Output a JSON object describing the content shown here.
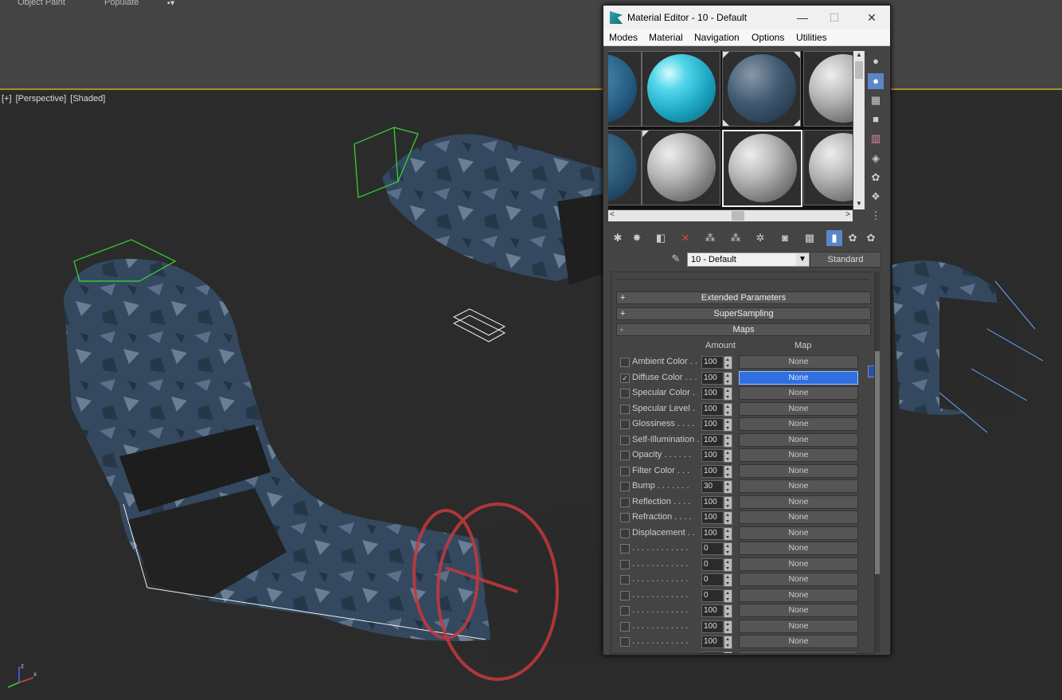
{
  "app": {
    "top_tabs": [
      "Object Paint",
      "Populate"
    ]
  },
  "viewport": {
    "label_parts": [
      "[+]",
      "[Perspective]",
      "[Shaded]"
    ],
    "axis_labels": {
      "z": "z",
      "x": "x"
    }
  },
  "material_editor": {
    "title": "Material Editor - 10 - Default",
    "window_buttons": {
      "minimize": "—",
      "maximize": "☐",
      "close": "✕"
    },
    "menu": [
      "Modes",
      "Material",
      "Navigation",
      "Options",
      "Utilities"
    ],
    "material_name": "10 - Default",
    "material_type": "Standard",
    "rollouts": [
      {
        "sign": "+",
        "label": "Extended Parameters"
      },
      {
        "sign": "+",
        "label": "SuperSampling"
      },
      {
        "sign": "-",
        "label": "Maps"
      }
    ],
    "maps_header": {
      "amount": "Amount",
      "map": "Map"
    },
    "maps": [
      {
        "label": "Ambient Color . .",
        "checked": false,
        "amount": "100",
        "map": "None",
        "selected": false
      },
      {
        "label": "Diffuse Color . . .",
        "checked": true,
        "amount": "100",
        "map": "None",
        "selected": true
      },
      {
        "label": "Specular Color  .",
        "checked": false,
        "amount": "100",
        "map": "None",
        "selected": false
      },
      {
        "label": "Specular Level  .",
        "checked": false,
        "amount": "100",
        "map": "None",
        "selected": false
      },
      {
        "label": "Glossiness  . . . .",
        "checked": false,
        "amount": "100",
        "map": "None",
        "selected": false
      },
      {
        "label": "Self-Illumination .",
        "checked": false,
        "amount": "100",
        "map": "None",
        "selected": false
      },
      {
        "label": "Opacity . . . . . .",
        "checked": false,
        "amount": "100",
        "map": "None",
        "selected": false
      },
      {
        "label": "Filter Color  . . .",
        "checked": false,
        "amount": "100",
        "map": "None",
        "selected": false
      },
      {
        "label": "Bump  . . . . . . .",
        "checked": false,
        "amount": "30",
        "map": "None",
        "selected": false
      },
      {
        "label": "Reflection  . . . .",
        "checked": false,
        "amount": "100",
        "map": "None",
        "selected": false
      },
      {
        "label": "Refraction  . . . .",
        "checked": false,
        "amount": "100",
        "map": "None",
        "selected": false
      },
      {
        "label": "Displacement  . .",
        "checked": false,
        "amount": "100",
        "map": "None",
        "selected": false
      },
      {
        "label": ". . . . . . . . . . . .",
        "checked": false,
        "amount": "0",
        "map": "None",
        "selected": false
      },
      {
        "label": ". . . . . . . . . . . .",
        "checked": false,
        "amount": "0",
        "map": "None",
        "selected": false
      },
      {
        "label": ". . . . . . . . . . . .",
        "checked": false,
        "amount": "0",
        "map": "None",
        "selected": false
      },
      {
        "label": ". . . . . . . . . . . .",
        "checked": false,
        "amount": "0",
        "map": "None",
        "selected": false
      },
      {
        "label": ". . . . . . . . . . . .",
        "checked": false,
        "amount": "100",
        "map": "None",
        "selected": false
      },
      {
        "label": ". . . . . . . . . . . .",
        "checked": false,
        "amount": "100",
        "map": "None",
        "selected": false
      },
      {
        "label": ". . . . . . . . . . . .",
        "checked": false,
        "amount": "100",
        "map": "None",
        "selected": false
      },
      {
        "label": ". . . . . . . . . . . .",
        "checked": false,
        "amount": "100",
        "map": "None",
        "selected": false
      }
    ],
    "side_tools": [
      "sample-type-icon",
      "backlight-icon",
      "background-icon",
      "uv-tiling-icon",
      "video-color-check-icon",
      "make-preview-icon",
      "options-icon",
      "select-by-material-icon",
      "material-map-navigator-icon"
    ],
    "toolbar_tools": [
      "get-material-icon",
      "put-to-scene-icon",
      "assign-to-selection-icon",
      "reset-map-icon",
      "make-copy-icon",
      "make-unique-icon",
      "put-to-library-icon",
      "material-id-icon",
      "show-map-icon",
      "show-shaded-icon",
      "show-end-result-icon",
      "go-to-parent-icon",
      "go-forward-icon"
    ],
    "accent_color": "#2f6fe0"
  }
}
